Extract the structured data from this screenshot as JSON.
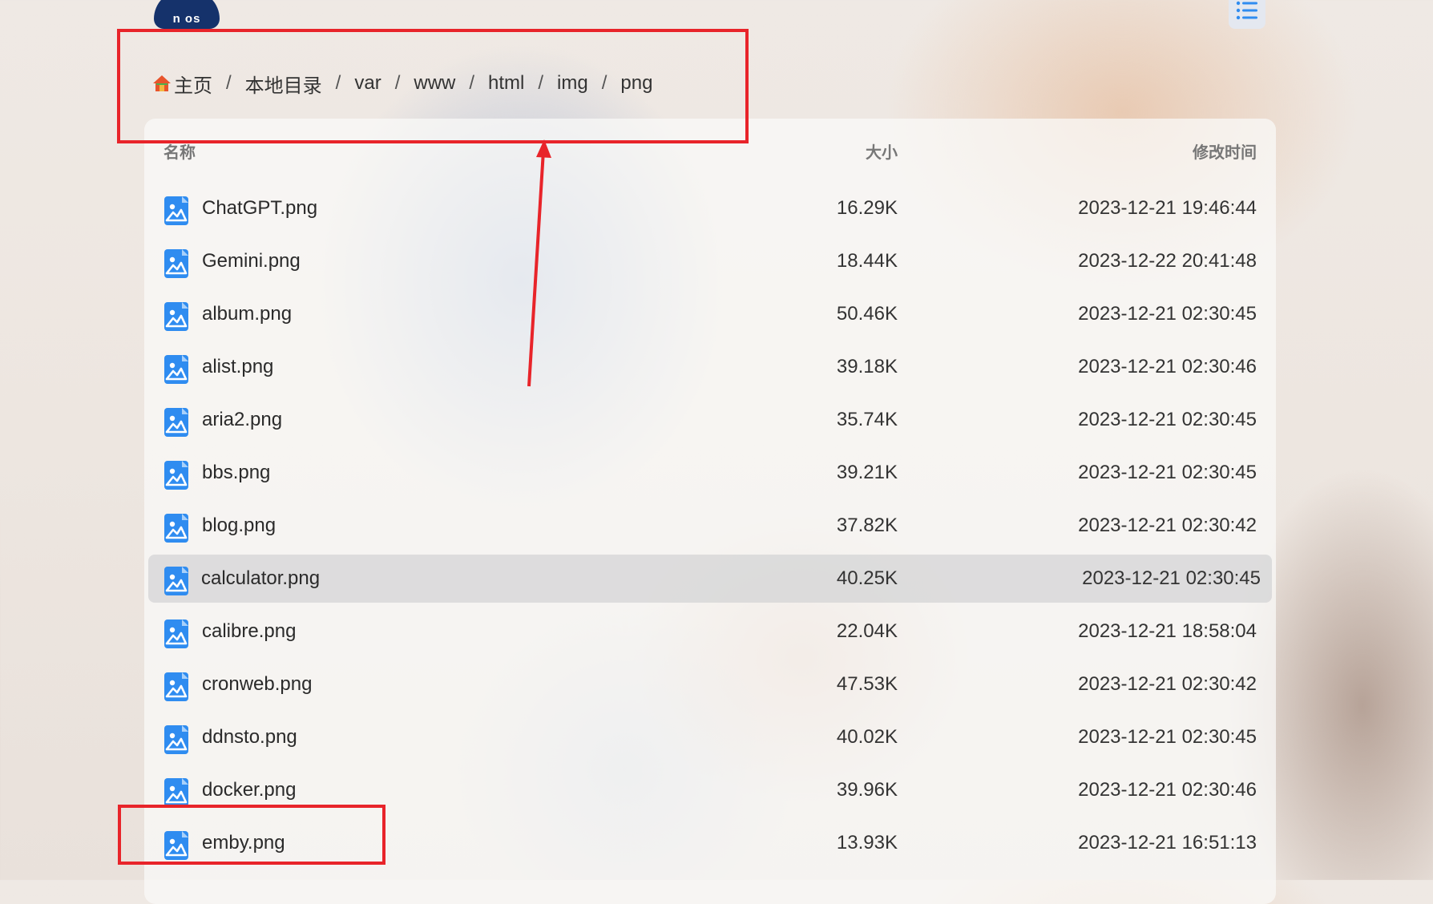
{
  "logo": {
    "text": "n os"
  },
  "breadcrumb": [
    {
      "label": "主页"
    },
    {
      "label": "本地目录"
    },
    {
      "label": "var"
    },
    {
      "label": "www"
    },
    {
      "label": "html"
    },
    {
      "label": "img"
    },
    {
      "label": "png"
    }
  ],
  "breadcrumb_separator": "/",
  "columns": {
    "name": "名称",
    "size": "大小",
    "time": "修改时间"
  },
  "files": [
    {
      "name": "ChatGPT.png",
      "size": "16.29K",
      "time": "2023-12-21 19:46:44"
    },
    {
      "name": "Gemini.png",
      "size": "18.44K",
      "time": "2023-12-22 20:41:48"
    },
    {
      "name": "album.png",
      "size": "50.46K",
      "time": "2023-12-21 02:30:45"
    },
    {
      "name": "alist.png",
      "size": "39.18K",
      "time": "2023-12-21 02:30:46"
    },
    {
      "name": "aria2.png",
      "size": "35.74K",
      "time": "2023-12-21 02:30:45"
    },
    {
      "name": "bbs.png",
      "size": "39.21K",
      "time": "2023-12-21 02:30:45"
    },
    {
      "name": "blog.png",
      "size": "37.82K",
      "time": "2023-12-21 02:30:42"
    },
    {
      "name": "calculator.png",
      "size": "40.25K",
      "time": "2023-12-21 02:30:45",
      "selected": true
    },
    {
      "name": "calibre.png",
      "size": "22.04K",
      "time": "2023-12-21 18:58:04"
    },
    {
      "name": "cronweb.png",
      "size": "47.53K",
      "time": "2023-12-21 02:30:42"
    },
    {
      "name": "ddnsto.png",
      "size": "40.02K",
      "time": "2023-12-21 02:30:45"
    },
    {
      "name": "docker.png",
      "size": "39.96K",
      "time": "2023-12-21 02:30:46"
    },
    {
      "name": "emby.png",
      "size": "13.93K",
      "time": "2023-12-21 16:51:13"
    }
  ],
  "icons": {
    "file": "image-file-icon",
    "home": "home-icon",
    "menu": "list-menu-icon"
  },
  "colors": {
    "accent": "#2f8cf0",
    "annotation": "#e8242a",
    "selected_row": "#d4d4d6"
  }
}
